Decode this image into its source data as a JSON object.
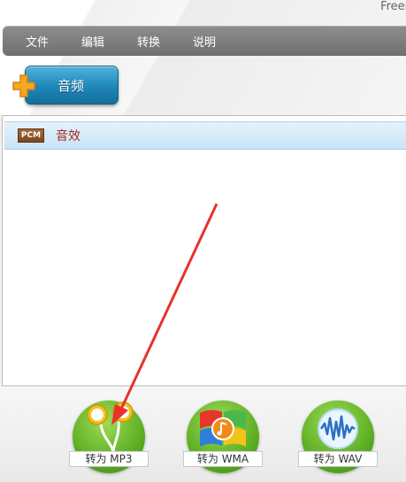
{
  "app": {
    "title": "Freer"
  },
  "menu": {
    "items": [
      "文件",
      "编辑",
      "转换",
      "说明"
    ]
  },
  "toolbar": {
    "add_audio_label": "音频"
  },
  "file_list": {
    "items": [
      {
        "format_badge": "PCM",
        "name": "音效"
      }
    ]
  },
  "convert_buttons": [
    {
      "label": "转为 MP3",
      "icon": "earphones-icon"
    },
    {
      "label": "转为 WMA",
      "icon": "windows-media-icon"
    },
    {
      "label": "转为 WAV",
      "icon": "waveform-icon"
    }
  ],
  "colors": {
    "menubar": "#7d7d7d",
    "accent_blue": "#1f86b8",
    "selection": "#c9e3f6",
    "item_text": "#a52a1a",
    "convert_green": "#5cae22",
    "annotation_arrow": "#e8322c"
  }
}
